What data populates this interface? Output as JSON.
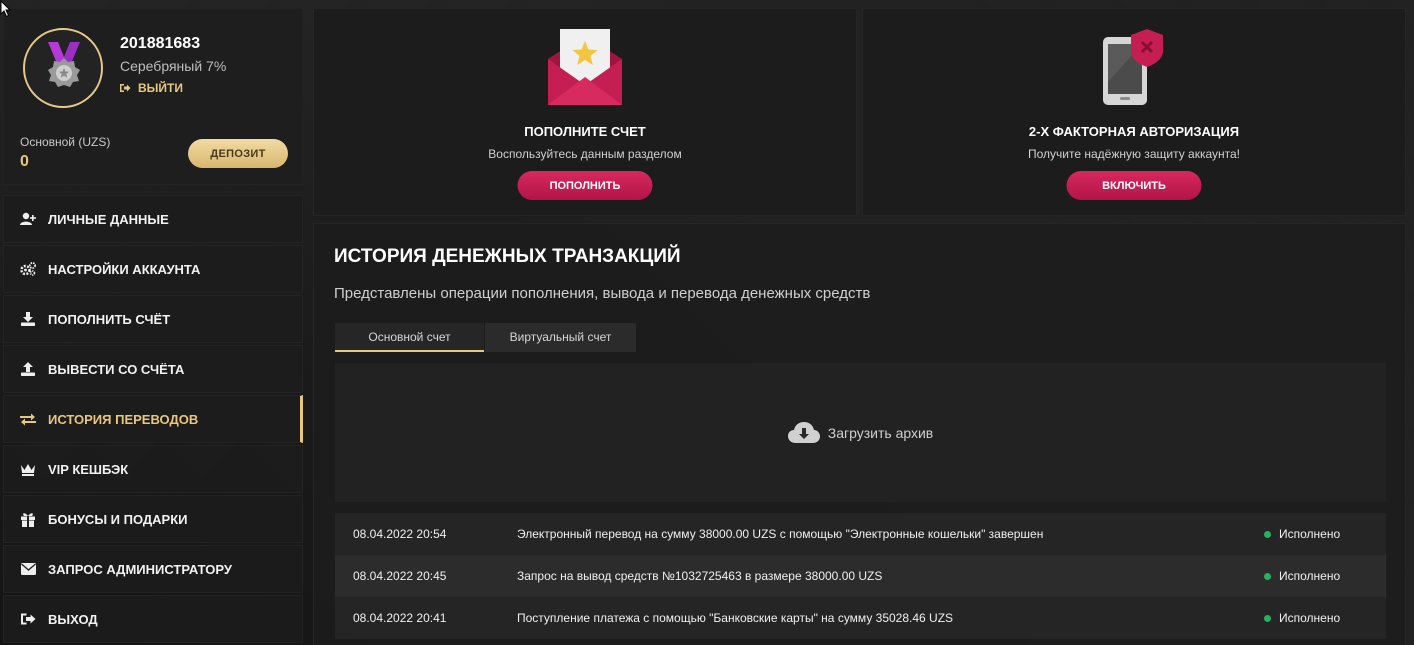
{
  "profile": {
    "user_id": "201881683",
    "level": "Серебряный 7%",
    "logout_label": "ВЫЙТИ",
    "balance_label": "Основной (UZS)",
    "balance_value": "0",
    "deposit_label": "ДЕПОЗИТ"
  },
  "menu": {
    "items": [
      {
        "label": "ЛИЧНЫЕ ДАННЫЕ",
        "icon": "user-plus-icon"
      },
      {
        "label": "НАСТРОЙКИ АККАУНТА",
        "icon": "gears-icon"
      },
      {
        "label": "ПОПОЛНИТЬ СЧЁТ",
        "icon": "download-icon"
      },
      {
        "label": "ВЫВЕСТИ СО СЧЁТА",
        "icon": "upload-icon"
      },
      {
        "label": "ИСТОРИЯ ПЕРЕВОДОВ",
        "icon": "exchange-icon",
        "active": true
      },
      {
        "label": "VIP КЕШБЭК",
        "icon": "crown-icon"
      },
      {
        "label": "БОНУСЫ И ПОДАРКИ",
        "icon": "gift-icon"
      },
      {
        "label": "ЗАПРОС АДМИНИСТРАТОРУ",
        "icon": "envelope-icon"
      },
      {
        "label": "ВЫХОД",
        "icon": "sign-out-icon"
      }
    ]
  },
  "cards": {
    "deposit": {
      "title": "ПОПОЛНИТЕ СЧЕТ",
      "subtitle": "Воспользуйтесь данным разделом",
      "button": "ПОПОЛНИТЬ",
      "icon": "envelope-star-icon"
    },
    "twofa": {
      "title": "2-Х ФАКТОРНАЯ АВТОРИЗАЦИЯ",
      "subtitle": "Получите надёжную защиту аккаунта!",
      "button": "ВКЛЮЧИТЬ",
      "icon": "phone-shield-icon"
    }
  },
  "history": {
    "title": "ИСТОРИЯ ДЕНЕЖНЫХ ТРАНЗАКЦИЙ",
    "subtitle": "Представлены операции пополнения, вывода и перевода денежных средств",
    "tabs": [
      {
        "label": "Основной счет",
        "active": true
      },
      {
        "label": "Виртуальный счет",
        "active": false
      }
    ],
    "archive_label": "Загрузить архив",
    "transactions": [
      {
        "date": "08.04.2022 20:54",
        "description": "Электронный перевод на сумму 38000.00 UZS с помощью \"Электронные кошельки\" завершен",
        "status": "Исполнено"
      },
      {
        "date": "08.04.2022 20:45",
        "description": "Запрос на вывод средств №1032725463 в размере 38000.00 UZS",
        "status": "Исполнено"
      },
      {
        "date": "08.04.2022 20:41",
        "description": "Поступление платежа с помощью \"Банковские карты\" на сумму 35028.46 UZS",
        "status": "Исполнено"
      }
    ]
  },
  "colors": {
    "accent_gold": "#e7c77e",
    "accent_pink": "#c81d53",
    "status_green": "#25b25e"
  }
}
